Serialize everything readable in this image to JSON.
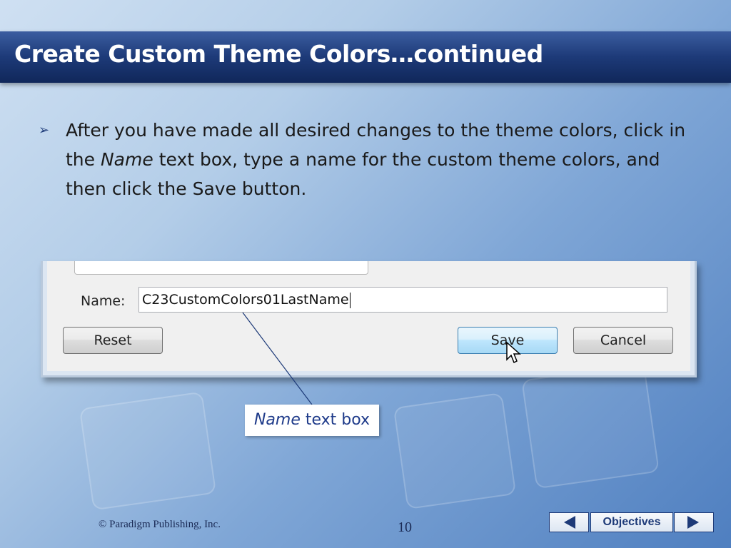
{
  "slide": {
    "title": "Create Custom Theme Colors…continued",
    "bullet": {
      "part1": "After you have made all desired changes to the theme colors, click in the ",
      "emph": "Name",
      "part2": " text box, type a name for the custom theme colors, and then click the Save button."
    }
  },
  "dialog": {
    "name_label": "Name:",
    "name_value": "C23CustomColors01LastName",
    "reset_label": "Reset",
    "save_label": "Save",
    "cancel_label": "Cancel"
  },
  "callout": {
    "emph": "Name",
    "rest": " text box"
  },
  "footer": {
    "copyright": "© Paradigm Publishing, Inc.",
    "page_number": "10",
    "objectives_label": "Objectives",
    "prev_icon": "left-triangle-icon",
    "next_icon": "right-triangle-icon"
  }
}
